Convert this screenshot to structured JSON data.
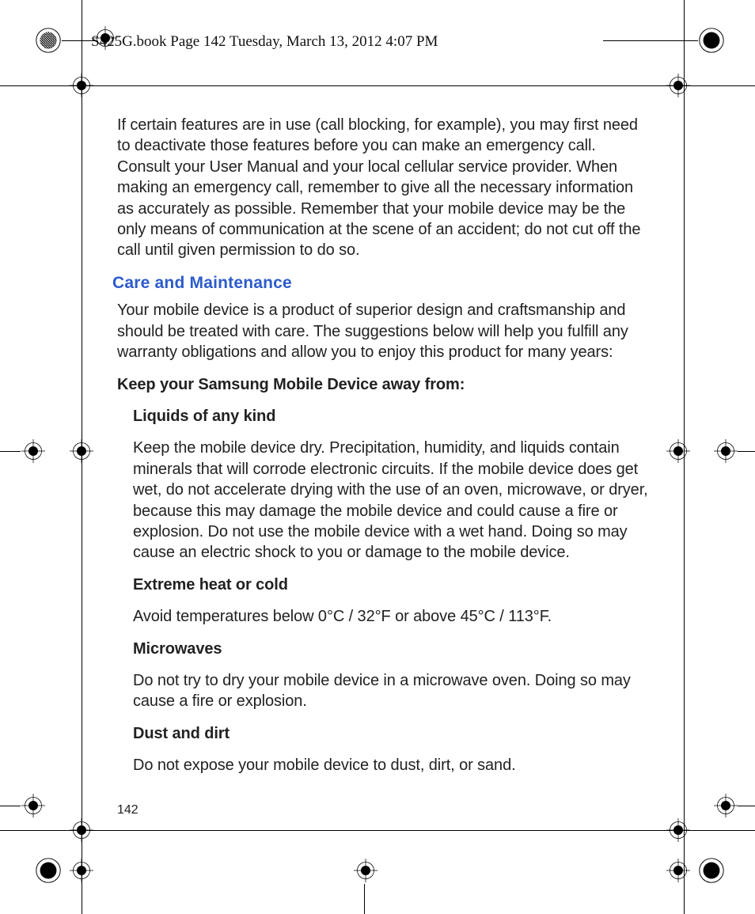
{
  "header": {
    "text": "S425G.book  Page 142  Tuesday, March 13, 2012  4:07 PM"
  },
  "page_number": "142",
  "body": {
    "intro": "If certain features are in use (call blocking, for example), you may first need to deactivate those features before you can make an emergency call. Consult your User Manual and your local cellular service provider. When making an emergency call, remember to give all the necessary information as accurately as possible. Remember that your mobile device may be the only means of communication at the scene of an accident; do not cut off the call until given permission to do so.",
    "section_title": "Care and Maintenance",
    "section_intro": "Your mobile device is a product of superior design and craftsmanship and should be treated with care. The suggestions below will help you fulfill any warranty obligations and allow you to enjoy this product for many years:",
    "keep_away_heading": "Keep your Samsung Mobile Device away from:",
    "items": [
      {
        "title": "Liquids of any kind",
        "text": "Keep the mobile device dry. Precipitation, humidity, and liquids contain minerals that will corrode electronic circuits. If the mobile device does get wet, do not accelerate drying with the use of an oven, microwave, or dryer, because this may damage the mobile device and could cause a fire or explosion. Do not use the mobile device with a wet hand. Doing so may cause an electric shock to you or damage to the mobile device."
      },
      {
        "title": "Extreme heat or cold",
        "text": "Avoid temperatures below 0°C / 32°F or above 45°C / 113°F."
      },
      {
        "title": "Microwaves",
        "text": "Do not try to dry your mobile device in a microwave oven. Doing so may cause a fire or explosion."
      },
      {
        "title": "Dust and dirt",
        "text": "Do not expose your mobile device to dust, dirt, or sand."
      }
    ]
  }
}
